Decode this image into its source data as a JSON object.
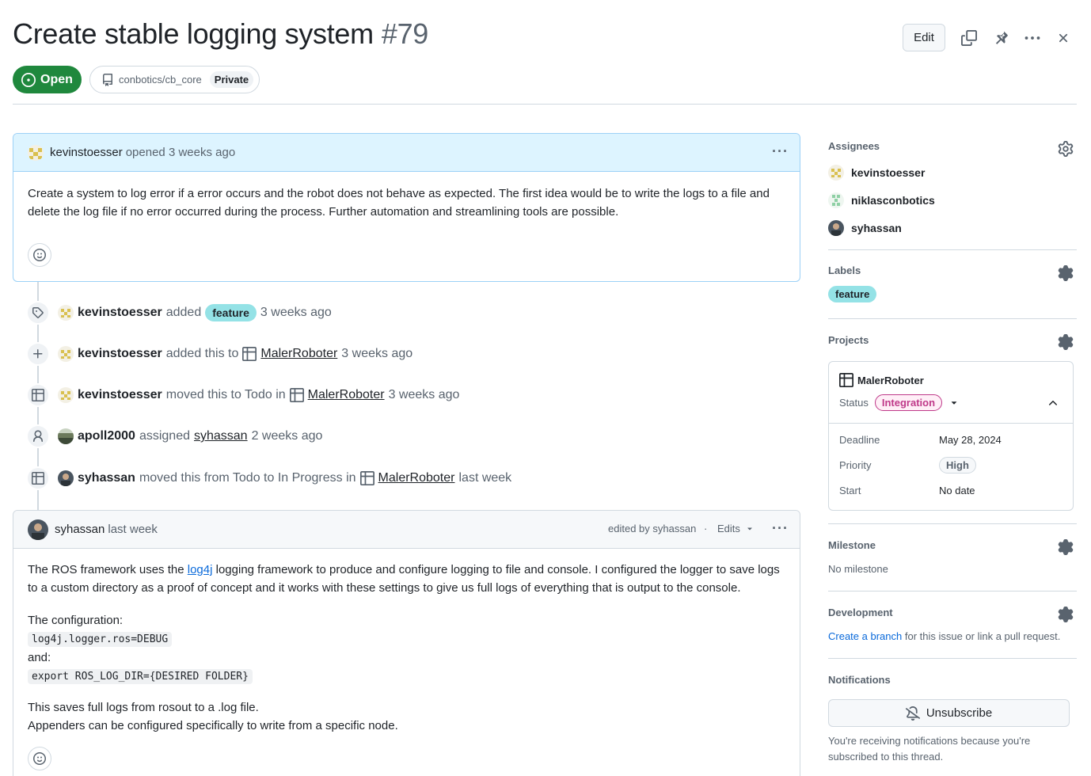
{
  "issue": {
    "title": "Create stable logging system",
    "number": "#79",
    "state": "Open",
    "repo": "conbotics/cb_core",
    "visibility": "Private"
  },
  "header": {
    "edit_label": "Edit"
  },
  "op_comment": {
    "author": "kevinstoesser",
    "meta": "opened 3 weeks ago",
    "body": "Create a system to log error if a error occurs and the robot does not behave as expected. The first idea would be to write the logs to a file and delete the log file if no error occurred during the process. Further automation and streamlining tools are possible."
  },
  "timeline": [
    {
      "icon": "tag-icon",
      "actor": "kevinstoesser",
      "action": "added",
      "label": "feature",
      "time": "3 weeks ago"
    },
    {
      "icon": "plus-icon",
      "actor": "kevinstoesser",
      "action": "added this to",
      "project": "MalerRoboter",
      "time": "3 weeks ago"
    },
    {
      "icon": "table-icon",
      "actor": "kevinstoesser",
      "action": "moved this to Todo in",
      "project": "MalerRoboter",
      "time": "3 weeks ago"
    },
    {
      "icon": "person-icon",
      "actor": "apoll2000",
      "action": "assigned",
      "target": "syhassan",
      "time": "2 weeks ago"
    },
    {
      "icon": "table-icon",
      "actor": "syhassan",
      "action": "moved this from Todo to In Progress in",
      "project": "MalerRoboter",
      "time": "last week"
    }
  ],
  "second_comment": {
    "author": "syhassan",
    "time": "last week",
    "edited": "edited by syhassan",
    "edits_label": "Edits",
    "p1_before": "The ROS framework uses the ",
    "p1_link": "log4j",
    "p1_after": " logging framework to produce and configure logging to file and console. I configured the logger to save logs to a custom directory as a proof of concept and it works with these settings to give us full logs of everything that is output to the console.",
    "config_label": "The configuration:",
    "code1": "log4j.logger.ros=DEBUG",
    "and_label": "and:",
    "code2": "export ROS_LOG_DIR={DESIRED FOLDER}",
    "p3_line1": "This saves full logs from rosout to a .log file.",
    "p3_line2": "Appenders can be configured specifically to write from a specific node."
  },
  "sidebar": {
    "assignees_title": "Assignees",
    "assignees": [
      "kevinstoesser",
      "niklasconbotics",
      "syhassan"
    ],
    "labels_title": "Labels",
    "labels": [
      "feature"
    ],
    "projects_title": "Projects",
    "project": {
      "name": "MalerRoboter",
      "status_label": "Status",
      "status_value": "Integration",
      "deadline_label": "Deadline",
      "deadline_value": "May 28, 2024",
      "priority_label": "Priority",
      "priority_value": "High",
      "start_label": "Start",
      "start_value": "No date"
    },
    "milestone_title": "Milestone",
    "milestone_value": "No milestone",
    "development_title": "Development",
    "development_link": "Create a branch",
    "development_rest": " for this issue or link a pull request.",
    "notifications_title": "Notifications",
    "unsubscribe_label": "Unsubscribe",
    "notifications_reason": "You're receiving notifications because you're subscribed to this thread."
  },
  "colors": {
    "open_green": "#1f883d",
    "label_feature": "#94e2e6",
    "status_integration": "#bf3989",
    "link_blue": "#0969da"
  }
}
